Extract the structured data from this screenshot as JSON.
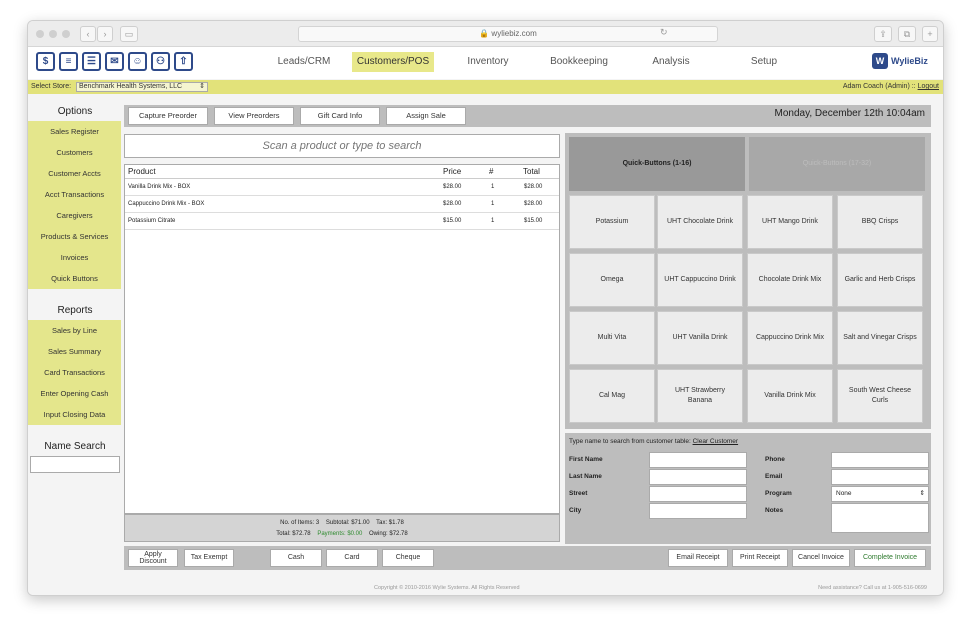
{
  "browser": {
    "url": "wyliebiz.com"
  },
  "nav": {
    "tabs": [
      "Leads/CRM",
      "Customers/POS",
      "Inventory",
      "Bookkeeping",
      "Analysis",
      "Setup"
    ],
    "active": "Customers/POS",
    "logo": "WylieBiz"
  },
  "store": {
    "label": "Select Store:",
    "value": "Benchmark Health Systems, LLC",
    "user": "Adam Coach (Admin)",
    "logout": "Logout",
    "sep": "::"
  },
  "sidebar": {
    "options_title": "Options",
    "options": [
      "Sales Register",
      "Customers",
      "Customer Accts",
      "Acct Transactions",
      "Caregivers",
      "Products & Services",
      "Invoices",
      "Quick Buttons"
    ],
    "reports_title": "Reports",
    "reports": [
      "Sales by Line",
      "Sales Summary",
      "Card Transactions",
      "Enter Opening Cash",
      "Input Closing Data"
    ],
    "search_title": "Name Search"
  },
  "topbar": {
    "buttons": [
      "Capture Preorder",
      "View Preorders",
      "Gift Card Info",
      "Assign Sale"
    ],
    "date": "Monday, December 12th 10:04am"
  },
  "scan": {
    "placeholder": "Scan a product or type to search"
  },
  "products": {
    "headers": {
      "product": "Product",
      "price": "Price",
      "qty": "#",
      "total": "Total"
    },
    "rows": [
      {
        "name": "Vanilla Drink Mix - BOX",
        "price": "$28.00",
        "qty": "1",
        "total": "$28.00"
      },
      {
        "name": "Cappuccino Drink Mix - BOX",
        "price": "$28.00",
        "qty": "1",
        "total": "$28.00"
      },
      {
        "name": "Potassium Citrate",
        "price": "$15.00",
        "qty": "1",
        "total": "$15.00"
      }
    ]
  },
  "totals": {
    "items": "No. of Items: 3",
    "subtotal": "Subtotal: $71.00",
    "tax": "Tax: $1.78",
    "total": "Total: $72.78",
    "payments": "Payments: $0.00",
    "owing": "Owing: $72.78"
  },
  "bottom": {
    "apply_line1": "Apply",
    "apply_line2": "Discount",
    "tax_exempt": "Tax Exempt",
    "cash": "Cash",
    "card": "Card",
    "cheque": "Cheque",
    "email_receipt": "Email Receipt",
    "print_receipt": "Print Receipt",
    "cancel_invoice": "Cancel Invoice",
    "complete_invoice": "Complete Invoice"
  },
  "quick": {
    "tabs": [
      "Quick-Buttons (1-16)",
      "Quick-Buttons (17-32)"
    ],
    "buttons": [
      "Potassium",
      "UHT Chocolate Drink",
      "UHT Mango Drink",
      "BBQ Crisps",
      "Omega",
      "UHT Cappuccino Drink",
      "Chocolate Drink Mix",
      "Garlic and Herb Crisps",
      "Multi Vita",
      "UHT Vanilla Drink",
      "Cappuccino Drink Mix",
      "Salt and Vinegar Crisps",
      "Cal Mag",
      "UHT Strawberry Banana",
      "Vanilla Drink Mix",
      "South West Cheese Curls"
    ]
  },
  "customer": {
    "hint": "Type name to search from customer table:",
    "clear": "Clear Customer",
    "first": "First Name",
    "last": "Last Name",
    "street": "Street",
    "city": "City",
    "phone": "Phone",
    "email": "Email",
    "program": "Program",
    "program_value": "None",
    "notes": "Notes"
  },
  "footer": {
    "copyright": "Copyright © 2010-2016 Wylie Systems. All Rights Reserved",
    "help": "Need assistance? Call us at 1-905-516-0699"
  },
  "colors": {
    "accent": "#e4e68c",
    "brand": "#2e4a8a"
  }
}
